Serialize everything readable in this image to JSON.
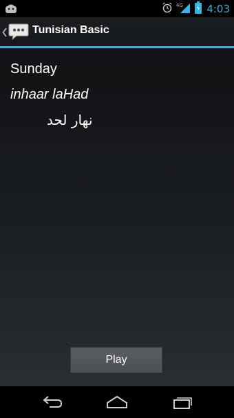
{
  "status_bar": {
    "time": "4:03",
    "network_label": "4G",
    "icons": [
      "android-notification-icon",
      "alarm-icon",
      "signal-icon",
      "battery-icon"
    ],
    "time_color": "#33b5e5"
  },
  "action_bar": {
    "title": "Tunisian Basic",
    "accent_color": "#33b5e5"
  },
  "phrase": {
    "english": "Sunday",
    "transliteration": "inhaar laHad",
    "arabic": "نهار لحد"
  },
  "play_button": {
    "label": "Play"
  },
  "nav_bar": {
    "buttons": [
      "back-icon",
      "home-icon",
      "recent-apps-icon"
    ]
  }
}
